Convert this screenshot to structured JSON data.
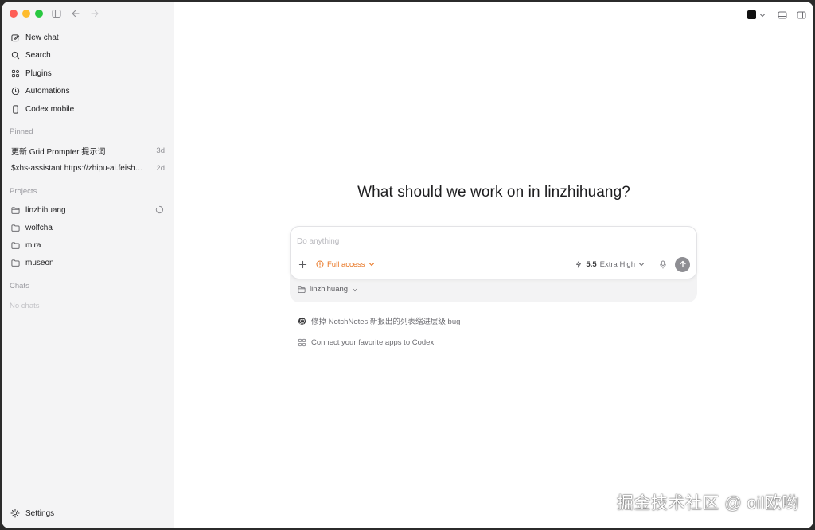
{
  "sidebar": {
    "nav": [
      {
        "label": "New chat",
        "icon": "compose-icon"
      },
      {
        "label": "Search",
        "icon": "search-icon"
      },
      {
        "label": "Plugins",
        "icon": "plugins-icon"
      },
      {
        "label": "Automations",
        "icon": "clock-icon"
      },
      {
        "label": "Codex mobile",
        "icon": "phone-icon"
      }
    ],
    "pinned_label": "Pinned",
    "pinned": [
      {
        "title": "更新 Grid Prompter 提示词",
        "age": "3d"
      },
      {
        "title": "$xhs-assistant https://zhipu-ai.feish…",
        "age": "2d"
      }
    ],
    "projects_label": "Projects",
    "projects": [
      {
        "name": "linzhihuang"
      },
      {
        "name": "wolfcha"
      },
      {
        "name": "mira"
      },
      {
        "name": "museon"
      }
    ],
    "chats_label": "Chats",
    "no_chats": "No chats",
    "settings_label": "Settings"
  },
  "main": {
    "headline": "What should we work on in linzhihuang?",
    "composer": {
      "placeholder": "Do anything",
      "access_label": "Full access",
      "model_version": "5.5",
      "model_effort": "Extra High",
      "project": "linzhihuang"
    },
    "suggestions": [
      {
        "text": "修掉 NotchNotes 新报出的列表缩进层级 bug",
        "icon": "github-icon"
      },
      {
        "text": "Connect your favorite apps to Codex",
        "icon": "apps-grid-icon"
      }
    ]
  },
  "watermark": "掘金技术社区 @ oil欧哟",
  "colors": {
    "accent_orange": "#e8731f",
    "sidebar_bg": "#f4f4f5",
    "send_button": "#8e8e93"
  }
}
